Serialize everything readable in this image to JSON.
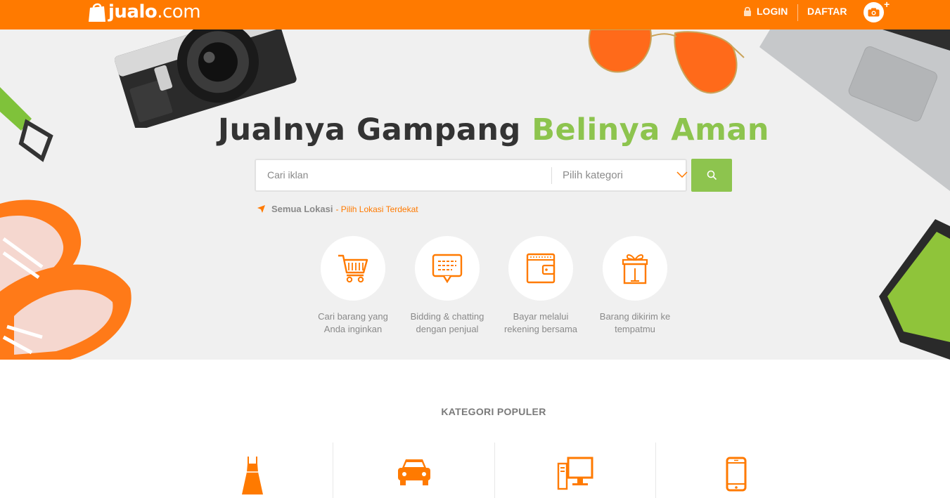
{
  "header": {
    "logo_text": "jualo",
    "logo_suffix": ".com",
    "login_label": "LOGIN",
    "register_label": "DAFTAR",
    "camera_plus": "+"
  },
  "hero": {
    "headline_part1": "Jualnya Gampang",
    "headline_part2": "Belinya Aman",
    "search_placeholder": "Cari iklan",
    "category_placeholder": "Pilih kategori",
    "location_all": "Semua Lokasi",
    "location_nearest": "- Pilih Lokasi Terdekat"
  },
  "features": [
    {
      "icon": "shopping-cart-icon",
      "line1": "Cari barang yang",
      "line2": "Anda inginkan"
    },
    {
      "icon": "chat-bubble-icon",
      "line1": "Bidding & chatting",
      "line2": "dengan penjual"
    },
    {
      "icon": "wallet-icon",
      "line1": "Bayar melalui",
      "line2": "rekening bersama"
    },
    {
      "icon": "gift-box-icon",
      "line1": "Barang dikirim ke",
      "line2": "tempatmu"
    }
  ],
  "popular": {
    "title": "KATEGORI POPULER",
    "categories": [
      {
        "icon": "dress-icon"
      },
      {
        "icon": "car-icon"
      },
      {
        "icon": "computer-icon"
      },
      {
        "icon": "smartphone-icon"
      }
    ]
  },
  "colors": {
    "brand_orange": "#ff7a00",
    "accent_green": "#8dc44e",
    "hero_bg": "#f0f0f0",
    "text_dark": "#333333",
    "text_muted": "#8a8a8a"
  }
}
